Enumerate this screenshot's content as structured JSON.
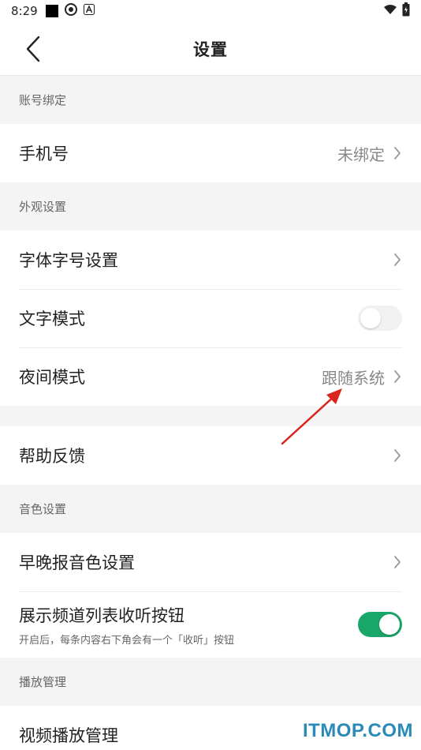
{
  "status_bar": {
    "time": "8:29",
    "icons": [
      "app-square-icon",
      "aperture-icon",
      "a-badge-icon",
      "wifi-icon",
      "battery-icon"
    ]
  },
  "header": {
    "title": "设置",
    "back_icon": "chevron-left-icon"
  },
  "sections": {
    "account": {
      "title": "账号绑定",
      "phone": {
        "label": "手机号",
        "value": "未绑定"
      }
    },
    "appearance": {
      "title": "外观设置",
      "font": {
        "label": "字体字号设置"
      },
      "text_mode": {
        "label": "文字模式",
        "enabled": false
      },
      "night_mode": {
        "label": "夜间模式",
        "value": "跟随系统"
      }
    },
    "help": {
      "feedback": {
        "label": "帮助反馈"
      }
    },
    "voice": {
      "title": "音色设置",
      "voice_setting": {
        "label": "早晚报音色设置"
      },
      "listen_button": {
        "label": "展示频道列表收听按钮",
        "subtitle": "开启后，每条内容右下角会有一个「收听」按钮",
        "enabled": true
      }
    },
    "playback": {
      "title": "播放管理",
      "video": {
        "label": "视频播放管理"
      }
    }
  },
  "watermark": "ITMOP.COM",
  "colors": {
    "accent_green": "#1aa668",
    "annotation_red": "#d9251d",
    "watermark_blue": "#2a8ab8"
  }
}
